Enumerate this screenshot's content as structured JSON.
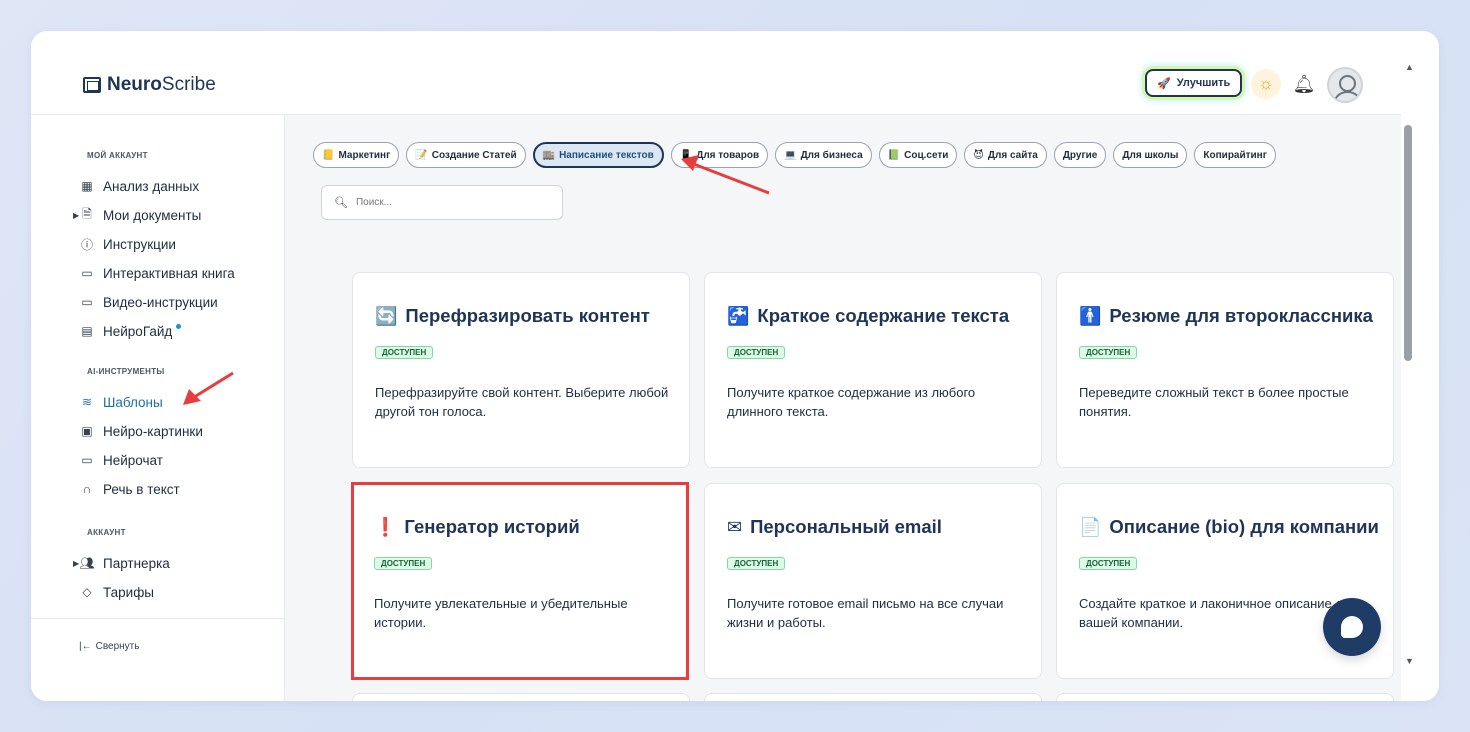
{
  "app": {
    "logo_bold": "Neuro",
    "logo_light": "Scribe"
  },
  "header": {
    "upgrade_label": "Улучшить"
  },
  "sidebar": {
    "section_account": "МОЙ АККАУНТ",
    "account_items": [
      {
        "label": "Анализ данных"
      },
      {
        "label": "Мои документы"
      },
      {
        "label": "Инструкции"
      },
      {
        "label": "Интерактивная книга"
      },
      {
        "label": "Видео-инструкции"
      },
      {
        "label": "НейроГайд"
      }
    ],
    "section_ai": "AI-ИНСТРУМЕНТЫ",
    "ai_items": [
      {
        "label": "Шаблоны"
      },
      {
        "label": "Нейро-картинки"
      },
      {
        "label": "Нейрочат"
      },
      {
        "label": "Речь в текст"
      }
    ],
    "section_acc": "АККАУНТ",
    "acc_items": [
      {
        "label": "Партнерка"
      },
      {
        "label": "Тарифы"
      }
    ],
    "collapse_label": "Свернуть"
  },
  "categories": [
    {
      "label": "Маркетинг",
      "icon": "📒"
    },
    {
      "label": "Создание Статей",
      "icon": "📝"
    },
    {
      "label": "Написание текстов",
      "icon": "🏬",
      "active": true
    },
    {
      "label": "Для товаров",
      "icon": "📱"
    },
    {
      "label": "Для бизнеса",
      "icon": "💻"
    },
    {
      "label": "Соц.сети",
      "icon": "📗"
    },
    {
      "label": "Для сайта",
      "icon": "😈"
    },
    {
      "label": "Другие",
      "icon": ""
    },
    {
      "label": "Для школы",
      "icon": ""
    },
    {
      "label": "Копирайтинг",
      "icon": ""
    }
  ],
  "search": {
    "placeholder": "Поиск..."
  },
  "cards": [
    {
      "icon": "🔄",
      "title": "Перефразировать контент",
      "badge": "ДОСТУПЕН",
      "desc": "Перефразируйте свой контент. Выберите любой другой тон голоса."
    },
    {
      "icon": "🚰",
      "title": "Краткое содержание текста",
      "badge": "ДОСТУПЕН",
      "desc": "Получите краткое содержание из любого длинного текста."
    },
    {
      "icon": "🚹",
      "title": "Резюме для второклассника",
      "badge": "ДОСТУПЕН",
      "desc": "Переведите сложный текст в более простые понятия."
    },
    {
      "icon": "❗",
      "title": "Генератор историй",
      "badge": "ДОСТУПЕН",
      "desc": "Получите увлекательные и убедительные истории."
    },
    {
      "icon": "✉",
      "title": "Персональный email",
      "badge": "ДОСТУПЕН",
      "desc": "Получите готовое email письмо на все случаи жизни и работы."
    },
    {
      "icon": "📄",
      "title": "Описание (bio) для компании",
      "badge": "ДОСТУПЕН",
      "desc": "Создайте краткое и лаконичное описание для вашей компании."
    }
  ],
  "colors": {
    "accent": "#1f3557",
    "highlight": "#e53e3e",
    "badge_bg": "#dcfce7"
  }
}
